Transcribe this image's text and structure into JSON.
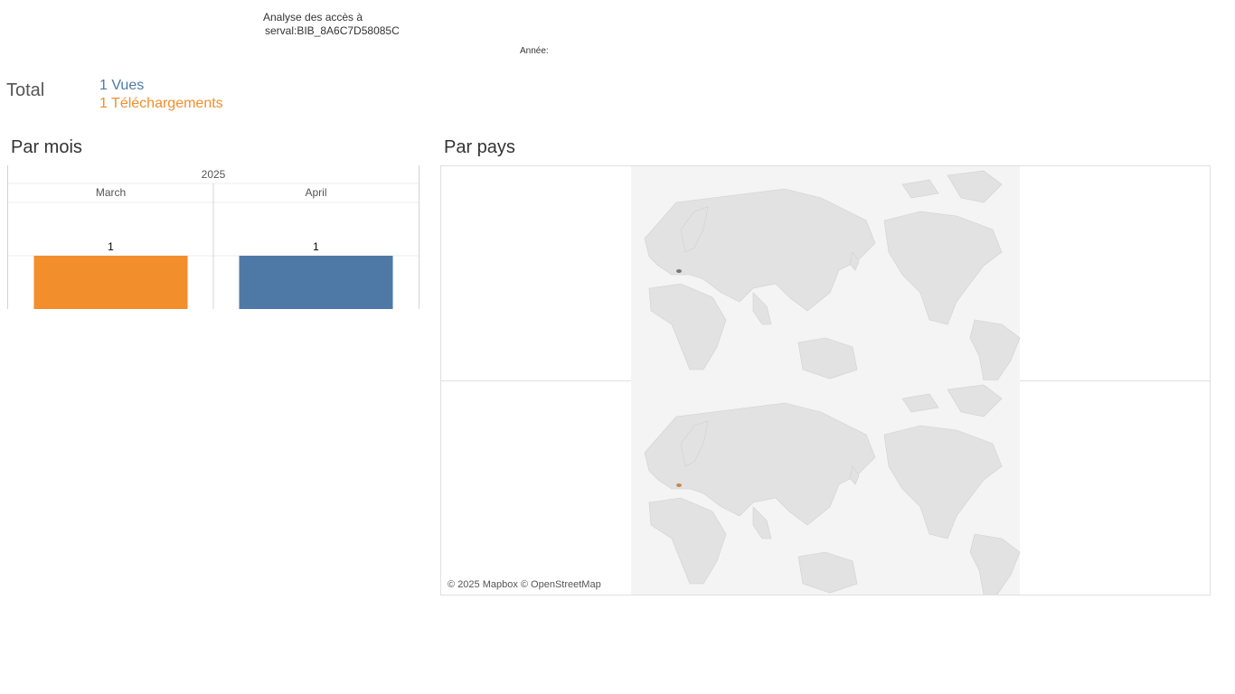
{
  "header": {
    "title_line1": "Analyse des accès à",
    "title_line2": "serval:BIB_8A6C7D58085C",
    "year_filter_label": "Année:"
  },
  "totals": {
    "label": "Total",
    "views": "1 Vues",
    "downloads": "1 Téléchargements"
  },
  "colors": {
    "views": "#4e79a7",
    "downloads": "#f28e2b"
  },
  "by_month": {
    "title": "Par mois"
  },
  "by_country": {
    "title": "Par pays",
    "attribution": "© 2025 Mapbox © OpenStreetMap"
  },
  "chart_data": {
    "type": "bar",
    "year": "2025",
    "categories": [
      "March",
      "April"
    ],
    "values": [
      1,
      1
    ],
    "series": [
      {
        "name": "Téléchargements",
        "category": "March",
        "value": 1,
        "color": "#f28e2b"
      },
      {
        "name": "Vues",
        "category": "April",
        "value": 1,
        "color": "#4e79a7"
      }
    ]
  }
}
